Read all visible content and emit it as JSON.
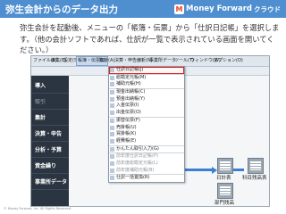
{
  "slide": {
    "title": "弥生会計からのデータ出力",
    "instruction": "弥生会計を起動後、メニューの「帳簿・伝票」から「仕訳日記帳」を選択します。（他の会計ソフトであれば、仕訳が一覧で表示されている画面を開いてください。）",
    "copyright": "© Money Forward, Inc. All Rights Reserved."
  },
  "logo": {
    "mark": "M",
    "name": "Money Forward",
    "cloud": "クラウド"
  },
  "app": {
    "menubar": [
      {
        "label": "ファイル(F)",
        "active": false
      },
      {
        "label": "編集(E)",
        "active": false
      },
      {
        "label": "設定(S)",
        "active": false
      },
      {
        "label": "帳簿・伝票(B)",
        "active": true
      },
      {
        "label": "集計(A)",
        "active": false
      },
      {
        "label": "決算・申告(K)",
        "active": false
      },
      {
        "label": "分析(N)",
        "active": false
      },
      {
        "label": "事業所データ",
        "active": false
      },
      {
        "label": "ツール(T)",
        "active": false
      },
      {
        "label": "ウィンドウ(W)",
        "active": false
      },
      {
        "label": "オプション(O)",
        "active": false
      }
    ],
    "nav": [
      {
        "label": "導入",
        "dim": false
      },
      {
        "label": "取引",
        "dim": true
      },
      {
        "label": "集計",
        "dim": false
      },
      {
        "label": "決算・申告",
        "dim": false
      },
      {
        "label": "分析・予算",
        "dim": false
      },
      {
        "label": "資金繰り",
        "dim": false
      },
      {
        "label": "事業所データ",
        "dim": false
      }
    ],
    "dropdown": [
      {
        "label": "仕訳日記帳(J)",
        "disabled": false,
        "sep": false,
        "highlight": true
      },
      {
        "label": "総勘定元帳(M)",
        "disabled": false,
        "sep": true,
        "highlight": false
      },
      {
        "label": "補助元帳(H)",
        "disabled": false,
        "sep": false,
        "highlight": false
      },
      {
        "label": "現金出納帳(C)",
        "disabled": false,
        "sep": true,
        "highlight": false
      },
      {
        "label": "預金出納帳(Y)",
        "disabled": false,
        "sep": false,
        "highlight": false
      },
      {
        "label": "入金伝票(I)",
        "disabled": false,
        "sep": false,
        "highlight": false
      },
      {
        "label": "出金伝票(O)",
        "disabled": false,
        "sep": false,
        "highlight": false
      },
      {
        "label": "振替伝票(F)",
        "disabled": false,
        "sep": true,
        "highlight": false
      },
      {
        "label": "売掛帳(U)",
        "disabled": false,
        "sep": false,
        "highlight": false
      },
      {
        "label": "買掛帳(K)",
        "disabled": false,
        "sep": false,
        "highlight": false
      },
      {
        "label": "経費帳(E)",
        "disabled": false,
        "sep": false,
        "highlight": false
      },
      {
        "label": "かんたん取引入力(G)",
        "disabled": false,
        "sep": true,
        "highlight": false
      },
      {
        "label": "前年度仕訳日記帳(P)",
        "disabled": true,
        "sep": true,
        "highlight": false
      },
      {
        "label": "前年度総勘定元帳(L)",
        "disabled": true,
        "sep": false,
        "highlight": false
      },
      {
        "label": "前年度補助元帳(B)",
        "disabled": true,
        "sep": false,
        "highlight": false
      },
      {
        "label": "仕訳一括置換(R)",
        "disabled": false,
        "sep": true,
        "highlight": false
      }
    ],
    "books": [
      {
        "label": "日計表"
      },
      {
        "label": "科目残高表"
      },
      {
        "label": "部門残高"
      }
    ]
  }
}
